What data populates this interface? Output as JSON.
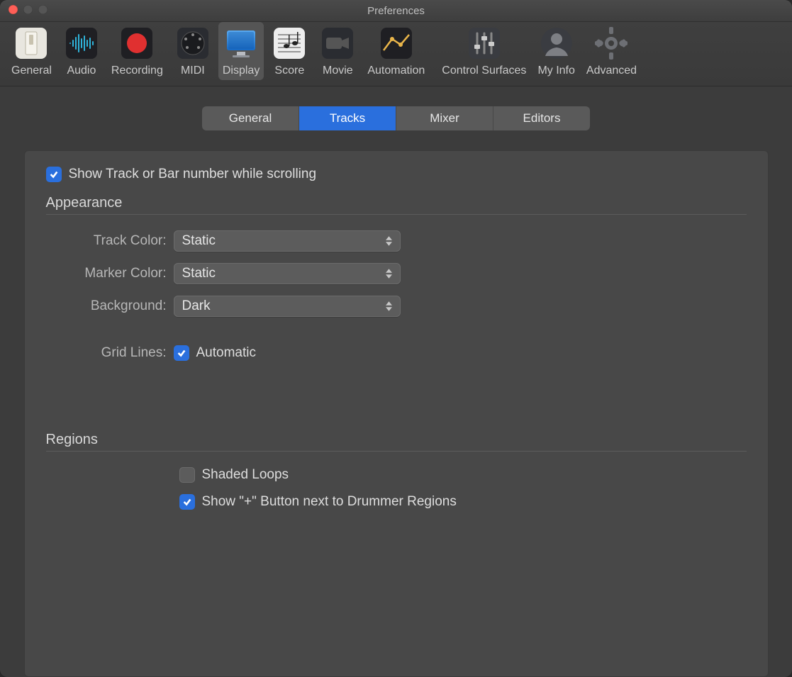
{
  "window": {
    "title": "Preferences"
  },
  "toolbar": {
    "items": [
      {
        "id": "general",
        "label": "General"
      },
      {
        "id": "audio",
        "label": "Audio"
      },
      {
        "id": "recording",
        "label": "Recording"
      },
      {
        "id": "midi",
        "label": "MIDI"
      },
      {
        "id": "display",
        "label": "Display"
      },
      {
        "id": "score",
        "label": "Score"
      },
      {
        "id": "movie",
        "label": "Movie"
      },
      {
        "id": "automation",
        "label": "Automation"
      },
      {
        "id": "control",
        "label": "Control Surfaces"
      },
      {
        "id": "myinfo",
        "label": "My Info"
      },
      {
        "id": "advanced",
        "label": "Advanced"
      }
    ],
    "selected": "display"
  },
  "tabs": {
    "items": [
      {
        "id": "general",
        "label": "General"
      },
      {
        "id": "tracks",
        "label": "Tracks"
      },
      {
        "id": "mixer",
        "label": "Mixer"
      },
      {
        "id": "editors",
        "label": "Editors"
      }
    ],
    "active": "tracks"
  },
  "tracks_panel": {
    "show_number_while_scrolling": {
      "label": "Show Track or Bar number while scrolling",
      "checked": true
    },
    "sections": {
      "appearance": {
        "title": "Appearance",
        "rows": {
          "track_color": {
            "label": "Track Color:",
            "value": "Static"
          },
          "marker_color": {
            "label": "Marker Color:",
            "value": "Static"
          },
          "background": {
            "label": "Background:",
            "value": "Dark"
          },
          "grid_lines": {
            "label": "Grid Lines:",
            "value": "Automatic",
            "checked": true
          }
        }
      },
      "regions": {
        "title": "Regions",
        "rows": {
          "shaded_loops": {
            "label": "Shaded Loops",
            "checked": false
          },
          "plus_drummer": {
            "label": "Show \"+\" Button next to Drummer Regions",
            "checked": true
          }
        }
      }
    }
  },
  "colors": {
    "accent": "#2a6fdd"
  }
}
